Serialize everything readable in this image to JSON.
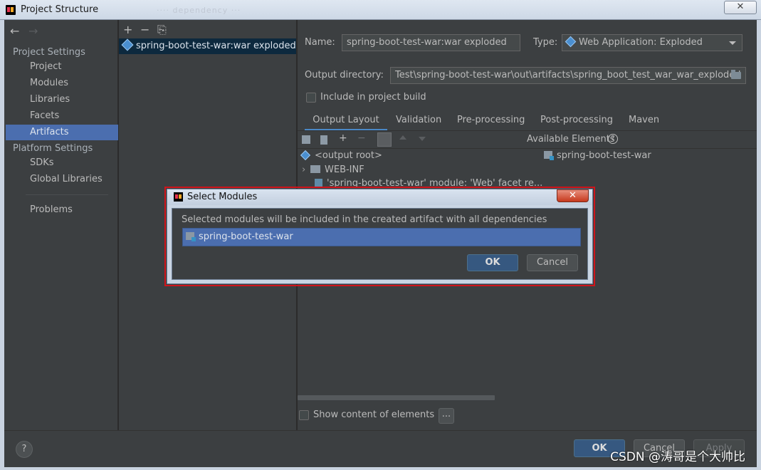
{
  "window": {
    "title": "Project Structure",
    "ghost_text": "···· dependency ···",
    "close_label": "✕"
  },
  "sidebar": {
    "back_icon": "←",
    "forward_icon": "→",
    "project_settings_heading": "Project Settings",
    "project_items": [
      "Project",
      "Modules",
      "Libraries",
      "Facets",
      "Artifacts"
    ],
    "platform_settings_heading": "Platform Settings",
    "platform_items": [
      "SDKs",
      "Global Libraries"
    ],
    "problems_label": "Problems",
    "active_item": "Artifacts"
  },
  "artifacts": {
    "toolbar": [
      "+",
      "−",
      "⎘"
    ],
    "selected": "spring-boot-test-war:war exploded"
  },
  "main": {
    "name_label": "Name:",
    "name_value": "spring-boot-test-war:war exploded",
    "type_label": "Type:",
    "type_value": "Web Application: Exploded",
    "output_label": "Output directory:",
    "output_value": "Test\\spring-boot-test-war\\out\\artifacts\\spring_boot_test_war_war_exploded",
    "include_label": "Include in project build",
    "tabs": [
      "Output Layout",
      "Validation",
      "Pre-processing",
      "Post-processing",
      "Maven"
    ],
    "active_tab": "Output Layout",
    "available_label": "Available Elements",
    "help_glyph": "?",
    "tree": {
      "root": "<output root>",
      "web_inf": "WEB-INF",
      "partial_line": "'spring-boot-test-war' module: 'Web' facet re..."
    },
    "available_item": "spring-boot-test-war",
    "show_content_label": "Show content of elements",
    "ellipsis_button": "..."
  },
  "footer": {
    "help": "?",
    "ok": "OK",
    "cancel": "Cancel",
    "apply": "Apply",
    "watermark": "CSDN @涛哥是个大帅比"
  },
  "modal": {
    "title": "Select Modules",
    "close_label": "✕",
    "message": "Selected modules will be included in the created artifact with all dependencies",
    "modules": [
      "spring-boot-test-war"
    ],
    "ok": "OK",
    "cancel": "Cancel"
  },
  "colors": {
    "background": "#3c3f41",
    "selection": "#4b6eaf",
    "primary_button": "#365880",
    "highlight_border": "#d0141b"
  }
}
